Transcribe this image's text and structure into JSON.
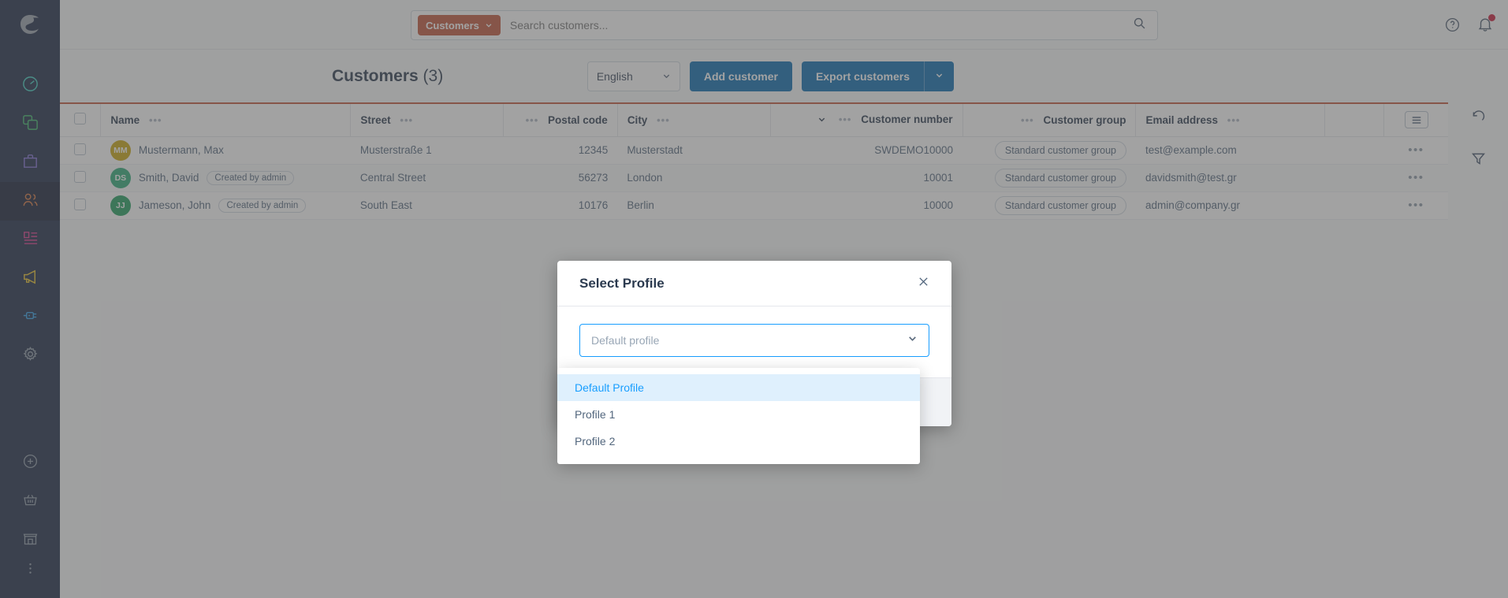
{
  "sidebar": {
    "logo_name": "shopware-logo",
    "items": [
      {
        "name": "dashboard",
        "icon": "gauge-icon",
        "color": "#3ecfc0",
        "active": false
      },
      {
        "name": "catalogue",
        "icon": "copy-icon",
        "color": "#3cb96a",
        "active": false
      },
      {
        "name": "orders",
        "icon": "bag-icon",
        "color": "#7f6dd4",
        "active": false
      },
      {
        "name": "customers",
        "icon": "users-icon",
        "color": "#d8763f",
        "active": true
      },
      {
        "name": "content",
        "icon": "content-icon",
        "color": "#d6398a",
        "active": false
      },
      {
        "name": "marketing",
        "icon": "megaphone-icon",
        "color": "#e8c02a",
        "active": false
      },
      {
        "name": "extensions",
        "icon": "plug-icon",
        "color": "#2f9fe8",
        "active": false
      },
      {
        "name": "settings",
        "icon": "gear-icon",
        "color": "#8d99a7",
        "active": false
      }
    ],
    "bottom_items": [
      {
        "name": "add",
        "icon": "plus-circle-icon",
        "color": "#8d99a7"
      },
      {
        "name": "basket",
        "icon": "basket-icon",
        "color": "#8d99a7"
      },
      {
        "name": "storefront",
        "icon": "storefront-icon",
        "color": "#8d99a7"
      },
      {
        "name": "more",
        "icon": "more-vertical-icon",
        "color": "#8d99a7"
      }
    ]
  },
  "search": {
    "scope_label": "Customers",
    "scope_caret": "chevron-down-icon",
    "placeholder": "Search customers...",
    "value": "",
    "search_icon": "search-icon",
    "scope_color": "#c0553a"
  },
  "topbar_right": {
    "help_icon": "help-circle-icon",
    "notifications_icon": "bell-icon",
    "has_notification": true,
    "notification_color": "#c91c3b"
  },
  "header": {
    "title": "Customers",
    "count": "(3)",
    "language": "English",
    "language_caret": "chevron-down-icon",
    "add_customer_label": "Add customer",
    "export_customers_label": "Export customers",
    "export_caret": "chevron-down-icon",
    "accent_color": "#0b6cb0"
  },
  "grid": {
    "accent_bar_color": "#c0553a",
    "select_all_name": "select-all-checkbox",
    "settings_icon": "grid-settings-icon",
    "columns": [
      {
        "key": "name",
        "label": "Name",
        "align": "left",
        "menu": true,
        "sort": false
      },
      {
        "key": "street",
        "label": "Street",
        "align": "left",
        "menu": true,
        "sort": false
      },
      {
        "key": "postal_code",
        "label": "Postal code",
        "align": "right",
        "menu": true,
        "sort": false
      },
      {
        "key": "city",
        "label": "City",
        "align": "left",
        "menu": true,
        "sort": false
      },
      {
        "key": "customer_number",
        "label": "Customer number",
        "align": "right",
        "menu": true,
        "sort": true
      },
      {
        "key": "customer_group",
        "label": "Customer group",
        "align": "right",
        "menu": true,
        "sort": false
      },
      {
        "key": "email",
        "label": "Email address",
        "align": "left",
        "menu": true,
        "sort": false
      }
    ],
    "rows": [
      {
        "initials": "MM",
        "avatar_color": "#cba70e",
        "name": "Mustermann, Max",
        "badge": "",
        "street": "Musterstraße 1",
        "postal_code": "12345",
        "city": "Musterstadt",
        "customer_number": "SWDEMO10000",
        "customer_group": "Standard customer group",
        "email": "test@example.com"
      },
      {
        "initials": "DS",
        "avatar_color": "#2eab78",
        "name": "Smith, David",
        "badge": "Created by admin",
        "street": "Central Street",
        "postal_code": "56273",
        "city": "London",
        "customer_number": "10001",
        "customer_group": "Standard customer group",
        "email": "davidsmith@test.gr"
      },
      {
        "initials": "JJ",
        "avatar_color": "#1f9e5e",
        "name": "Jameson, John",
        "badge": "Created by admin",
        "street": "South East",
        "postal_code": "10176",
        "city": "Berlin",
        "customer_number": "10000",
        "customer_group": "Standard customer group",
        "email": "admin@company.gr"
      }
    ],
    "row_menu_icon": "more-horizontal-icon",
    "side_tools": [
      {
        "name": "refresh",
        "icon": "refresh-icon"
      },
      {
        "name": "filter",
        "icon": "filter-icon"
      }
    ]
  },
  "modal": {
    "title": "Select Profile",
    "close_icon": "close-icon",
    "select": {
      "placeholder": "Default profile",
      "value": "",
      "caret_icon": "chevron-down-icon",
      "focus_color": "#189eff"
    },
    "options": [
      {
        "label": "Default Profile",
        "selected": true
      },
      {
        "label": "Profile 1",
        "selected": false
      },
      {
        "label": "Profile 2",
        "selected": false
      }
    ]
  }
}
